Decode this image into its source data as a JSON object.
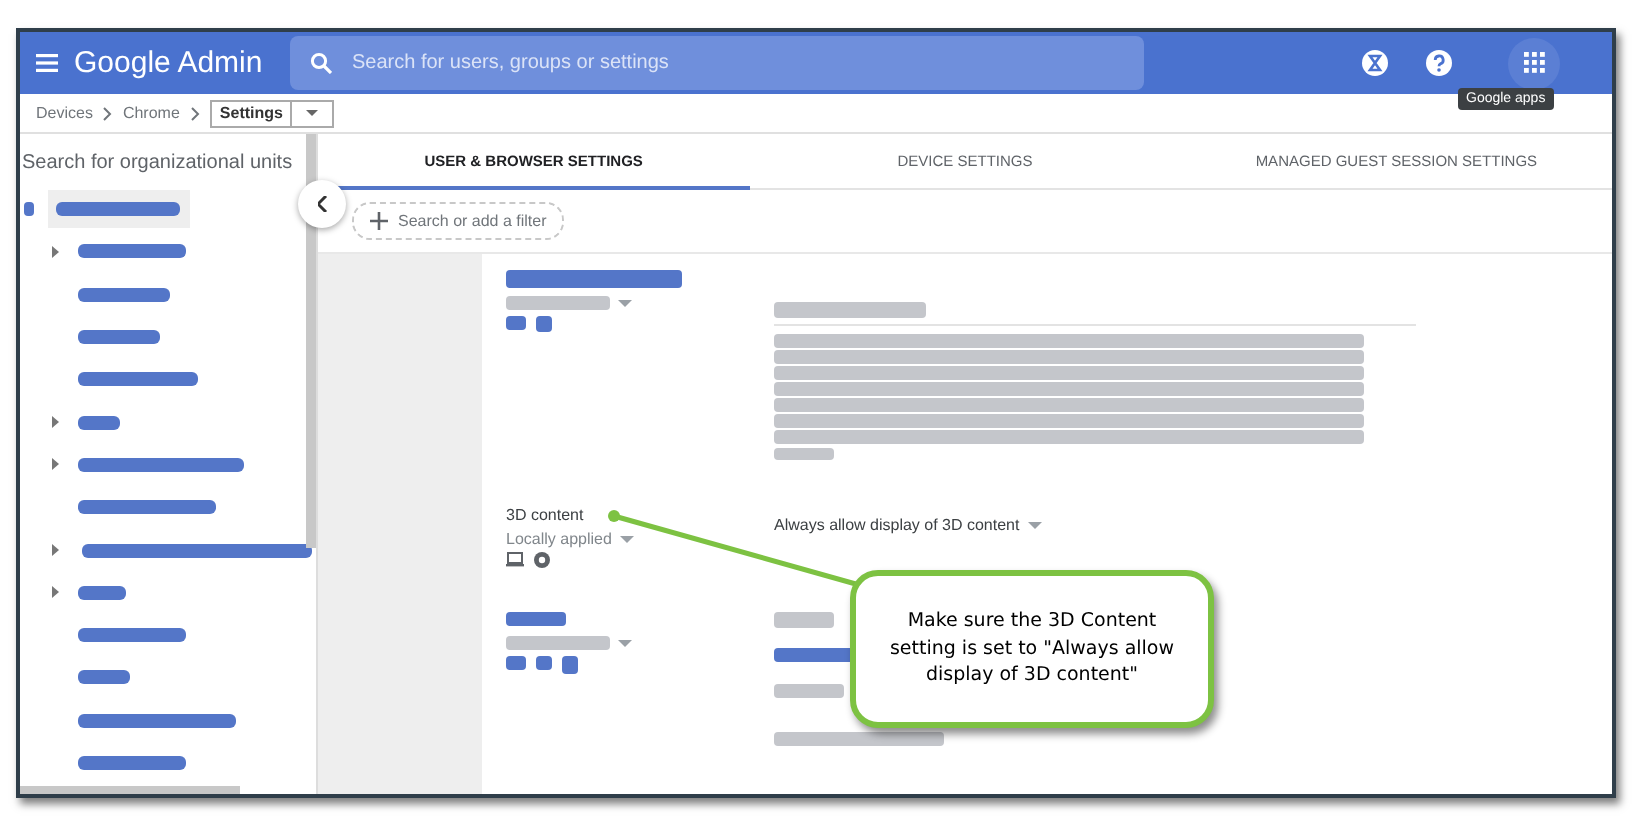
{
  "header": {
    "logo": "Google Admin",
    "search": {
      "placeholder": "Search for users, groups or settings"
    },
    "tooltip": "Google apps"
  },
  "breadcrumb": {
    "path": [
      "Devices",
      "Chrome"
    ],
    "current": "Settings"
  },
  "sidebar": {
    "search": {
      "placeholder": "Search for organizational units"
    },
    "units": [
      {
        "selected": true,
        "collapsible": false
      },
      {
        "selected": false,
        "collapsible": true
      },
      {
        "selected": false,
        "collapsible": false
      },
      {
        "selected": false,
        "collapsible": false
      },
      {
        "selected": false,
        "collapsible": false
      },
      {
        "selected": false,
        "collapsible": true
      },
      {
        "selected": false,
        "collapsible": true
      },
      {
        "selected": false,
        "collapsible": false
      },
      {
        "selected": false,
        "collapsible": true
      },
      {
        "selected": false,
        "collapsible": true
      },
      {
        "selected": false,
        "collapsible": false
      },
      {
        "selected": false,
        "collapsible": false
      },
      {
        "selected": false,
        "collapsible": false
      },
      {
        "selected": false,
        "collapsible": false
      }
    ]
  },
  "tabs": [
    {
      "label": "USER & BROWSER SETTINGS",
      "selected": true
    },
    {
      "label": "DEVICE SETTINGS",
      "selected": false
    },
    {
      "label": "MANAGED GUEST SESSION SETTINGS",
      "selected": false
    }
  ],
  "filter": {
    "placeholder": "Search or add a filter"
  },
  "settings": [
    {
      "kind": "redacted"
    },
    {
      "kind": "setting",
      "name": "3D content",
      "status": "Locally applied",
      "value": "Always allow display of 3D content"
    },
    {
      "kind": "redacted_short"
    }
  ],
  "callout": {
    "text": "Make sure the 3D Content setting is set to \"Always allow display of 3D content\""
  }
}
